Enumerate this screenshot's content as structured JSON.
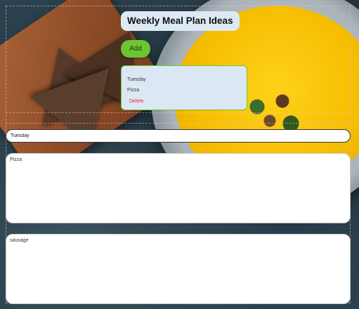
{
  "header": {
    "title": "Weekly Meal Plan Ideas"
  },
  "actions": {
    "add_label": "Add"
  },
  "meal_card": {
    "day": "Tuesday",
    "meal": "Pizza",
    "delete_label": "Delete"
  },
  "form": {
    "day_value": "Tuesday",
    "meal_value": "Pizza",
    "notes_value": "sausage"
  },
  "colors": {
    "accent_green": "#6cc633",
    "delete_red": "#e0302a",
    "panel_blue": "#dbe8f3"
  }
}
